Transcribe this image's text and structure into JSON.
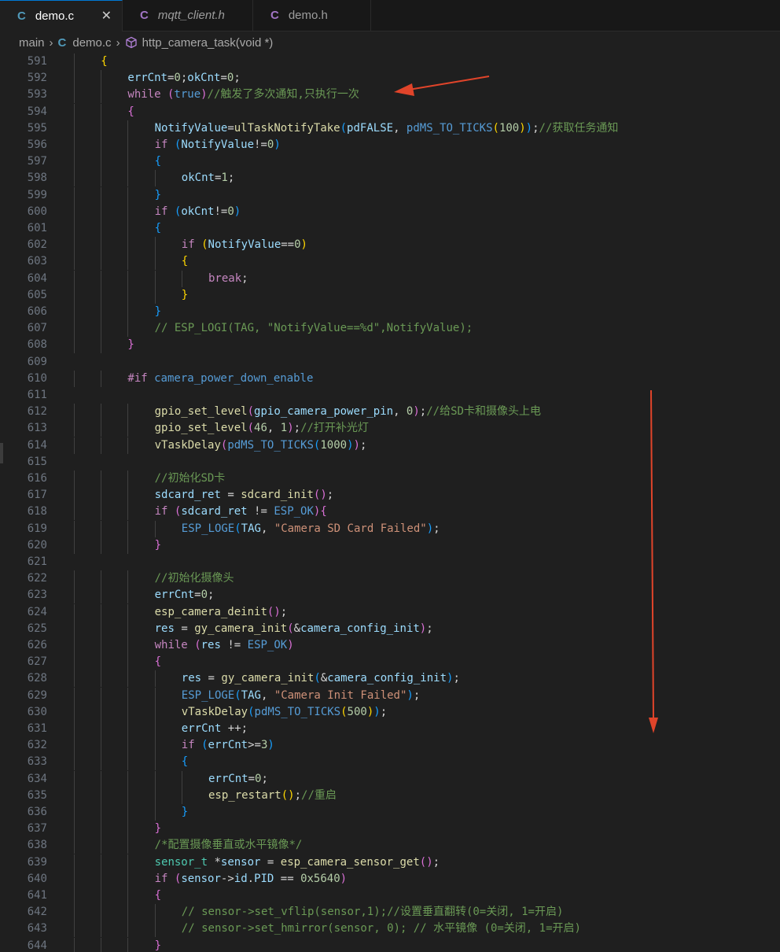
{
  "tabs": [
    {
      "label": "demo.c",
      "icon": "c-file-icon",
      "active": true
    },
    {
      "label": "mqtt_client.h",
      "icon": "c-header-icon",
      "active": false
    },
    {
      "label": "demo.h",
      "icon": "c-header-icon",
      "active": false
    }
  ],
  "tab_icon_letter": "C",
  "tab_close_glyph": "✕",
  "breadcrumb": {
    "folder": "main",
    "file": "demo.c",
    "symbol": "http_camera_task(void *)"
  },
  "colors": {
    "keyword": "#c586c0",
    "control": "#569cd6",
    "function": "#dcdcaa",
    "variable": "#9cdcfe",
    "number": "#b5cea8",
    "string": "#ce9178",
    "comment": "#6a9955",
    "annotation_arrow": "#e0442a"
  },
  "code_lines": [
    {
      "n": "591",
      "indent": 1,
      "t": [
        [
          "b1",
          "{"
        ]
      ]
    },
    {
      "n": "592",
      "indent": 2,
      "t": [
        [
          "var",
          "errCnt"
        ],
        [
          "plain",
          "="
        ],
        [
          "num",
          "0"
        ],
        [
          "plain",
          ";"
        ],
        [
          "var",
          "okCnt"
        ],
        [
          "plain",
          "="
        ],
        [
          "num",
          "0"
        ],
        [
          "plain",
          ";"
        ]
      ]
    },
    {
      "n": "593",
      "indent": 2,
      "t": [
        [
          "kw",
          "while"
        ],
        [
          "plain",
          " "
        ],
        [
          "b2",
          "("
        ],
        [
          "cond",
          "true"
        ],
        [
          "b2",
          ")"
        ],
        [
          "cmt",
          "//触发了多次通知,只执行一次"
        ]
      ]
    },
    {
      "n": "594",
      "indent": 2,
      "t": [
        [
          "b2",
          "{"
        ]
      ]
    },
    {
      "n": "595",
      "indent": 3,
      "t": [
        [
          "var",
          "NotifyValue"
        ],
        [
          "plain",
          "="
        ],
        [
          "fn",
          "ulTaskNotifyTake"
        ],
        [
          "b3",
          "("
        ],
        [
          "var",
          "pdFALSE"
        ],
        [
          "plain",
          ", "
        ],
        [
          "macro",
          "pdMS_TO_TICKS"
        ],
        [
          "b1",
          "("
        ],
        [
          "num",
          "100"
        ],
        [
          "b1",
          ")"
        ],
        [
          "b3",
          ")"
        ],
        [
          "plain",
          ";"
        ],
        [
          "cmt",
          "//获取任务通知"
        ]
      ]
    },
    {
      "n": "596",
      "indent": 3,
      "t": [
        [
          "kw",
          "if"
        ],
        [
          "plain",
          " "
        ],
        [
          "b3",
          "("
        ],
        [
          "var",
          "NotifyValue"
        ],
        [
          "plain",
          "!="
        ],
        [
          "num",
          "0"
        ],
        [
          "b3",
          ")"
        ]
      ]
    },
    {
      "n": "597",
      "indent": 3,
      "t": [
        [
          "b3",
          "{"
        ]
      ]
    },
    {
      "n": "598",
      "indent": 4,
      "t": [
        [
          "var",
          "okCnt"
        ],
        [
          "plain",
          "="
        ],
        [
          "num",
          "1"
        ],
        [
          "plain",
          ";"
        ]
      ]
    },
    {
      "n": "599",
      "indent": 3,
      "t": [
        [
          "b3",
          "}"
        ]
      ]
    },
    {
      "n": "600",
      "indent": 3,
      "t": [
        [
          "kw",
          "if"
        ],
        [
          "plain",
          " "
        ],
        [
          "b3",
          "("
        ],
        [
          "var",
          "okCnt"
        ],
        [
          "plain",
          "!="
        ],
        [
          "num",
          "0"
        ],
        [
          "b3",
          ")"
        ]
      ]
    },
    {
      "n": "601",
      "indent": 3,
      "t": [
        [
          "b3",
          "{"
        ]
      ]
    },
    {
      "n": "602",
      "indent": 4,
      "t": [
        [
          "kw",
          "if"
        ],
        [
          "plain",
          " "
        ],
        [
          "b1",
          "("
        ],
        [
          "var",
          "NotifyValue"
        ],
        [
          "plain",
          "=="
        ],
        [
          "num",
          "0"
        ],
        [
          "b1",
          ")"
        ]
      ]
    },
    {
      "n": "603",
      "indent": 4,
      "t": [
        [
          "b1",
          "{"
        ]
      ]
    },
    {
      "n": "604",
      "indent": 5,
      "t": [
        [
          "kw",
          "break"
        ],
        [
          "plain",
          ";"
        ]
      ]
    },
    {
      "n": "605",
      "indent": 4,
      "t": [
        [
          "b1",
          "}"
        ]
      ]
    },
    {
      "n": "606",
      "indent": 3,
      "t": [
        [
          "b3",
          "}"
        ]
      ]
    },
    {
      "n": "607",
      "indent": 3,
      "t": [
        [
          "cmt",
          "// ESP_LOGI(TAG, \"NotifyValue==%d\",NotifyValue);"
        ]
      ]
    },
    {
      "n": "608",
      "indent": 2,
      "t": [
        [
          "b2",
          "}"
        ]
      ]
    },
    {
      "n": "609",
      "indent": 0,
      "t": []
    },
    {
      "n": "610",
      "indent": 2,
      "t": [
        [
          "pp",
          "#if"
        ],
        [
          "plain",
          " "
        ],
        [
          "macro",
          "camera_power_down_enable"
        ]
      ]
    },
    {
      "n": "611",
      "indent": 0,
      "t": []
    },
    {
      "n": "612",
      "indent": 3,
      "t": [
        [
          "fn",
          "gpio_set_level"
        ],
        [
          "b2",
          "("
        ],
        [
          "var",
          "gpio_camera_power_pin"
        ],
        [
          "plain",
          ", "
        ],
        [
          "num",
          "0"
        ],
        [
          "b2",
          ")"
        ],
        [
          "plain",
          ";"
        ],
        [
          "cmt",
          "//给SD卡和摄像头上电"
        ]
      ]
    },
    {
      "n": "613",
      "indent": 3,
      "t": [
        [
          "fn",
          "gpio_set_level"
        ],
        [
          "b2",
          "("
        ],
        [
          "num",
          "46"
        ],
        [
          "plain",
          ", "
        ],
        [
          "num",
          "1"
        ],
        [
          "b2",
          ")"
        ],
        [
          "plain",
          ";"
        ],
        [
          "cmt",
          "//打开补光灯"
        ]
      ]
    },
    {
      "n": "614",
      "indent": 3,
      "t": [
        [
          "fn",
          "vTaskDelay"
        ],
        [
          "b2",
          "("
        ],
        [
          "macro",
          "pdMS_TO_TICKS"
        ],
        [
          "b3",
          "("
        ],
        [
          "num",
          "1000"
        ],
        [
          "b3",
          ")"
        ],
        [
          "b2",
          ")"
        ],
        [
          "plain",
          ";"
        ]
      ]
    },
    {
      "n": "615",
      "indent": 0,
      "t": []
    },
    {
      "n": "616",
      "indent": 3,
      "t": [
        [
          "cmt",
          "//初始化SD卡"
        ]
      ]
    },
    {
      "n": "617",
      "indent": 3,
      "t": [
        [
          "var",
          "sdcard_ret"
        ],
        [
          "plain",
          " = "
        ],
        [
          "fn",
          "sdcard_init"
        ],
        [
          "b2",
          "("
        ],
        [
          "b2",
          ")"
        ],
        [
          "plain",
          ";"
        ]
      ]
    },
    {
      "n": "618",
      "indent": 3,
      "t": [
        [
          "kw",
          "if"
        ],
        [
          "plain",
          " "
        ],
        [
          "b2",
          "("
        ],
        [
          "var",
          "sdcard_ret"
        ],
        [
          "plain",
          " != "
        ],
        [
          "macro",
          "ESP_OK"
        ],
        [
          "b2",
          ")"
        ],
        [
          "b2",
          "{"
        ]
      ]
    },
    {
      "n": "619",
      "indent": 4,
      "t": [
        [
          "macro",
          "ESP_LOGE"
        ],
        [
          "b3",
          "("
        ],
        [
          "var",
          "TAG"
        ],
        [
          "plain",
          ", "
        ],
        [
          "str",
          "\"Camera SD Card Failed\""
        ],
        [
          "b3",
          ")"
        ],
        [
          "plain",
          ";"
        ]
      ]
    },
    {
      "n": "620",
      "indent": 3,
      "t": [
        [
          "b2",
          "}"
        ]
      ]
    },
    {
      "n": "621",
      "indent": 0,
      "t": []
    },
    {
      "n": "622",
      "indent": 3,
      "t": [
        [
          "cmt",
          "//初始化摄像头"
        ]
      ]
    },
    {
      "n": "623",
      "indent": 3,
      "t": [
        [
          "var",
          "errCnt"
        ],
        [
          "plain",
          "="
        ],
        [
          "num",
          "0"
        ],
        [
          "plain",
          ";"
        ]
      ]
    },
    {
      "n": "624",
      "indent": 3,
      "t": [
        [
          "fn",
          "esp_camera_deinit"
        ],
        [
          "b2",
          "("
        ],
        [
          "b2",
          ")"
        ],
        [
          "plain",
          ";"
        ]
      ]
    },
    {
      "n": "625",
      "indent": 3,
      "t": [
        [
          "var",
          "res"
        ],
        [
          "plain",
          " = "
        ],
        [
          "fn",
          "gy_camera_init"
        ],
        [
          "b2",
          "("
        ],
        [
          "plain",
          "&"
        ],
        [
          "var",
          "camera_config_init"
        ],
        [
          "b2",
          ")"
        ],
        [
          "plain",
          ";"
        ]
      ]
    },
    {
      "n": "626",
      "indent": 3,
      "t": [
        [
          "kw",
          "while"
        ],
        [
          "plain",
          " "
        ],
        [
          "b2",
          "("
        ],
        [
          "var",
          "res"
        ],
        [
          "plain",
          " != "
        ],
        [
          "macro",
          "ESP_OK"
        ],
        [
          "b2",
          ")"
        ]
      ]
    },
    {
      "n": "627",
      "indent": 3,
      "t": [
        [
          "b2",
          "{"
        ]
      ]
    },
    {
      "n": "628",
      "indent": 4,
      "t": [
        [
          "var",
          "res"
        ],
        [
          "plain",
          " = "
        ],
        [
          "fn",
          "gy_camera_init"
        ],
        [
          "b3",
          "("
        ],
        [
          "plain",
          "&"
        ],
        [
          "var",
          "camera_config_init"
        ],
        [
          "b3",
          ")"
        ],
        [
          "plain",
          ";"
        ]
      ]
    },
    {
      "n": "629",
      "indent": 4,
      "t": [
        [
          "macro",
          "ESP_LOGE"
        ],
        [
          "b3",
          "("
        ],
        [
          "var",
          "TAG"
        ],
        [
          "plain",
          ", "
        ],
        [
          "str",
          "\"Camera Init Failed\""
        ],
        [
          "b3",
          ")"
        ],
        [
          "plain",
          ";"
        ]
      ]
    },
    {
      "n": "630",
      "indent": 4,
      "t": [
        [
          "fn",
          "vTaskDelay"
        ],
        [
          "b3",
          "("
        ],
        [
          "macro",
          "pdMS_TO_TICKS"
        ],
        [
          "b1",
          "("
        ],
        [
          "num",
          "500"
        ],
        [
          "b1",
          ")"
        ],
        [
          "b3",
          ")"
        ],
        [
          "plain",
          ";"
        ]
      ]
    },
    {
      "n": "631",
      "indent": 4,
      "t": [
        [
          "var",
          "errCnt"
        ],
        [
          "plain",
          " ++;"
        ]
      ]
    },
    {
      "n": "632",
      "indent": 4,
      "t": [
        [
          "kw",
          "if"
        ],
        [
          "plain",
          " "
        ],
        [
          "b3",
          "("
        ],
        [
          "var",
          "errCnt"
        ],
        [
          "plain",
          ">="
        ],
        [
          "num",
          "3"
        ],
        [
          "b3",
          ")"
        ]
      ]
    },
    {
      "n": "633",
      "indent": 4,
      "t": [
        [
          "b3",
          "{"
        ]
      ]
    },
    {
      "n": "634",
      "indent": 5,
      "t": [
        [
          "var",
          "errCnt"
        ],
        [
          "plain",
          "="
        ],
        [
          "num",
          "0"
        ],
        [
          "plain",
          ";"
        ]
      ]
    },
    {
      "n": "635",
      "indent": 5,
      "t": [
        [
          "fn",
          "esp_restart"
        ],
        [
          "b1",
          "("
        ],
        [
          "b1",
          ")"
        ],
        [
          "plain",
          ";"
        ],
        [
          "cmt",
          "//重启"
        ]
      ]
    },
    {
      "n": "636",
      "indent": 4,
      "t": [
        [
          "b3",
          "}"
        ]
      ]
    },
    {
      "n": "637",
      "indent": 3,
      "t": [
        [
          "b2",
          "}"
        ]
      ]
    },
    {
      "n": "638",
      "indent": 3,
      "t": [
        [
          "cmt",
          "/*配置摄像垂直或水平镜像*/"
        ]
      ]
    },
    {
      "n": "639",
      "indent": 3,
      "t": [
        [
          "type",
          "sensor_t"
        ],
        [
          "plain",
          " *"
        ],
        [
          "var",
          "sensor"
        ],
        [
          "plain",
          " = "
        ],
        [
          "fn",
          "esp_camera_sensor_get"
        ],
        [
          "b2",
          "("
        ],
        [
          "b2",
          ")"
        ],
        [
          "plain",
          ";"
        ]
      ]
    },
    {
      "n": "640",
      "indent": 3,
      "t": [
        [
          "kw",
          "if"
        ],
        [
          "plain",
          " "
        ],
        [
          "b2",
          "("
        ],
        [
          "var",
          "sensor"
        ],
        [
          "plain",
          "->"
        ],
        [
          "var",
          "id"
        ],
        [
          "plain",
          "."
        ],
        [
          "var",
          "PID"
        ],
        [
          "plain",
          " == "
        ],
        [
          "num",
          "0x5640"
        ],
        [
          "b2",
          ")"
        ]
      ]
    },
    {
      "n": "641",
      "indent": 3,
      "t": [
        [
          "b2",
          "{"
        ]
      ]
    },
    {
      "n": "642",
      "indent": 4,
      "t": [
        [
          "cmt",
          "// sensor->set_vflip(sensor,1);//设置垂直翻转(0=关闭, 1=开启)"
        ]
      ]
    },
    {
      "n": "643",
      "indent": 4,
      "t": [
        [
          "cmt",
          "// sensor->set_hmirror(sensor, 0); // 水平镜像 (0=关闭, 1=开启)"
        ]
      ]
    },
    {
      "n": "644",
      "indent": 3,
      "t": [
        [
          "b2",
          "}"
        ]
      ]
    }
  ],
  "annotations": [
    {
      "name": "arrow-pointing-to-while",
      "color": "#e0442a"
    },
    {
      "name": "arrow-pointing-down",
      "color": "#e0442a"
    }
  ]
}
